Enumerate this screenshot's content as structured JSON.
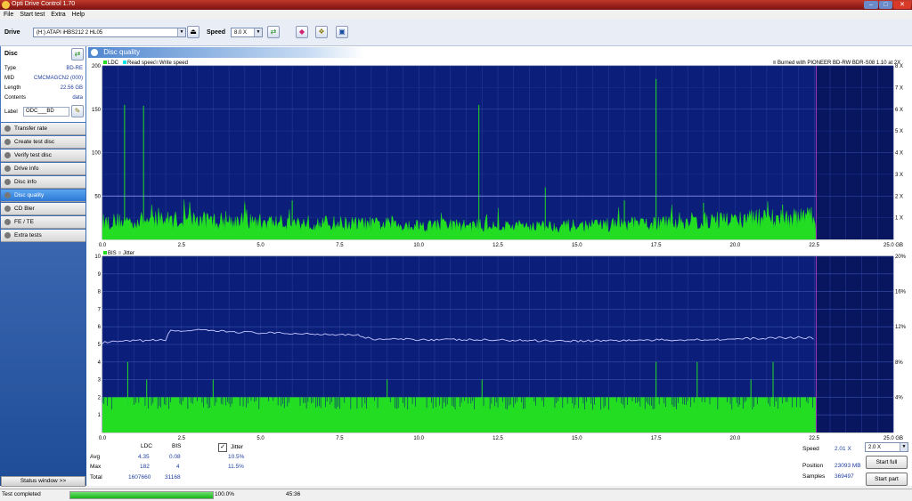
{
  "window": {
    "title": "Opti Drive Control 1.70"
  },
  "menu": [
    "File",
    "Start test",
    "Extra",
    "Help"
  ],
  "toolbar": {
    "drive_label": "Drive",
    "drive_value": "(H:)    ATAPI iHBS212   2 HL05",
    "speed_label": "Speed",
    "speed_value": "8.0 X"
  },
  "disc": {
    "header": "Disc",
    "rows": [
      {
        "k": "Type",
        "v": "BD-RE"
      },
      {
        "k": "MID",
        "v": "CMCMAGCN2 (000)"
      },
      {
        "k": "Length",
        "v": "22.56 GB"
      },
      {
        "k": "Contents",
        "v": "data"
      }
    ],
    "label_key": "Label",
    "label_value": "ODC___BD"
  },
  "nav": [
    {
      "label": "Transfer rate",
      "icon": "transfer-rate-icon"
    },
    {
      "label": "Create test disc",
      "icon": "create-disc-icon"
    },
    {
      "label": "Verify test disc",
      "icon": "verify-disc-icon"
    },
    {
      "label": "Drive info",
      "icon": "drive-info-icon"
    },
    {
      "label": "Disc info",
      "icon": "disc-info-icon"
    },
    {
      "label": "Disc quality",
      "icon": "disc-quality-icon",
      "active": true
    },
    {
      "label": "CD Bler",
      "icon": "cd-bler-icon"
    },
    {
      "label": "FE / TE",
      "icon": "fe-te-icon"
    },
    {
      "label": "Extra tests",
      "icon": "extra-tests-icon"
    }
  ],
  "status_window_label": "Status window >>",
  "panel_title": "Disc quality",
  "colors": {
    "plot_bg": "#0b1f7a",
    "ldc": "#22dd22",
    "read": "#00e5e5",
    "jitter": "#c8c8ff",
    "limit": "#a0a0ff"
  },
  "chart_data": [
    {
      "type": "area",
      "name": "LDC chart",
      "legend": [
        "LDC",
        "Read speed",
        "Write speed"
      ],
      "info_text": "Burned with PIONEER BD-RW   BDR-S08 1.10 at 2X",
      "x_ticks": [
        "0.0",
        "2.5",
        "5.0",
        "7.5",
        "10.0",
        "12.5",
        "15.0",
        "17.5",
        "20.0",
        "22.5",
        "25.0 GB"
      ],
      "y_left_ticks": [
        "200",
        "150",
        "100",
        "50"
      ],
      "y_right_ticks": [
        "8 X",
        "7 X",
        "6 X",
        "5 X",
        "4 X",
        "3 X",
        "2 X",
        "1 X"
      ],
      "xlim": [
        0,
        25
      ],
      "ylim": [
        0,
        200
      ],
      "limit_line": 50,
      "data_end": 22.56,
      "ldc_baseline": [
        [
          0,
          22
        ],
        [
          2.5,
          25
        ],
        [
          5,
          22
        ],
        [
          7.5,
          20
        ],
        [
          10,
          18
        ],
        [
          12.5,
          17
        ],
        [
          15,
          17
        ],
        [
          17.5,
          20
        ],
        [
          20,
          25
        ],
        [
          22.5,
          28
        ]
      ],
      "ldc_spikes": [
        [
          0.7,
          155
        ],
        [
          1.3,
          154
        ],
        [
          4.5,
          40
        ],
        [
          6.0,
          45
        ],
        [
          11.9,
          155
        ],
        [
          14,
          60
        ],
        [
          16.5,
          45
        ],
        [
          17.5,
          185
        ],
        [
          19.0,
          42
        ],
        [
          21.5,
          40
        ]
      ]
    },
    {
      "type": "area",
      "name": "BIS/Jitter chart",
      "legend": [
        "BIS",
        "Jitter"
      ],
      "x_ticks": [
        "0.0",
        "2.5",
        "5.0",
        "7.5",
        "10.0",
        "12.5",
        "15.0",
        "17.5",
        "20.0",
        "22.5",
        "25.0 GB"
      ],
      "y_left_ticks": [
        "10",
        "9",
        "8",
        "7",
        "6",
        "5",
        "4",
        "3",
        "2",
        "1"
      ],
      "y_right_ticks": [
        "20%",
        "16%",
        "12%",
        "8%",
        "4%"
      ],
      "xlim": [
        0,
        25
      ],
      "ylim": [
        0,
        10
      ],
      "data_end": 22.56,
      "bis_base": 2,
      "bis_spikes": [
        [
          0.8,
          4
        ],
        [
          1.4,
          3
        ],
        [
          3.5,
          3
        ],
        [
          9.0,
          3
        ],
        [
          12.0,
          3
        ],
        [
          17.5,
          4
        ],
        [
          18.8,
          4
        ],
        [
          20.5,
          3
        ],
        [
          21.2,
          4
        ]
      ],
      "jitter": [
        [
          0,
          10.2
        ],
        [
          1.0,
          10.4
        ],
        [
          2.0,
          10.5
        ],
        [
          2.1,
          11.5
        ],
        [
          3.0,
          11.6
        ],
        [
          5.0,
          11.3
        ],
        [
          8.0,
          11.1
        ],
        [
          8.5,
          10.6
        ],
        [
          12.0,
          10.5
        ],
        [
          15.0,
          10.4
        ],
        [
          18.0,
          10.5
        ],
        [
          20.0,
          10.6
        ],
        [
          22.0,
          10.8
        ],
        [
          22.5,
          10.7
        ]
      ],
      "jitter_ylim": [
        0,
        20
      ]
    }
  ],
  "stats": {
    "headers": [
      "LDC",
      "BIS"
    ],
    "jitter_label": "Jitter",
    "rows": [
      {
        "label": "Avg",
        "ldc": "4.35",
        "bis": "0.08",
        "jitter": "10.5%"
      },
      {
        "label": "Max",
        "ldc": "182",
        "bis": "4",
        "jitter": "11.5%"
      },
      {
        "label": "Total",
        "ldc": "1607660",
        "bis": "31168",
        "jitter": ""
      }
    ]
  },
  "right_panel": {
    "speed_label": "Speed",
    "speed_value": "2.01 X",
    "speed_select": "2.0 X",
    "position_label": "Position",
    "position_value": "23093 MB",
    "samples_label": "Samples",
    "samples_value": "369497",
    "start_full": "Start full",
    "start_part": "Start part"
  },
  "statusbar": {
    "text": "Test completed",
    "progress": 1.0,
    "progress_text": "100.0%",
    "time": "45:36"
  }
}
